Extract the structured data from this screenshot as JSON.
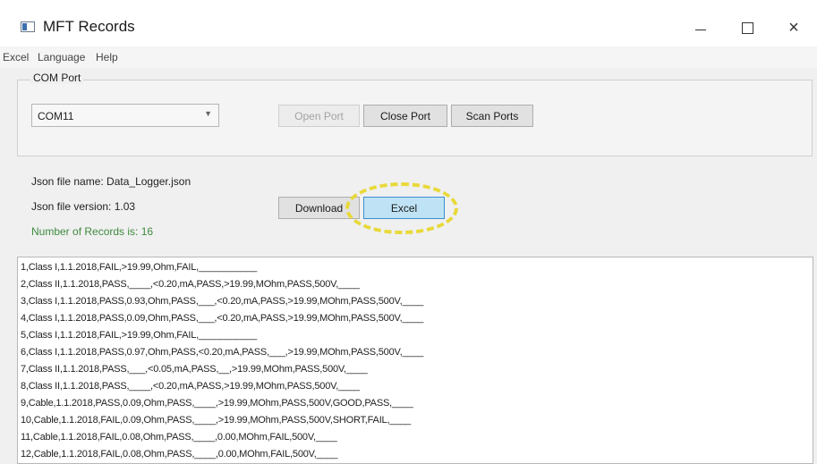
{
  "window": {
    "title": "MFT Records",
    "controls": {
      "minimize": "—",
      "maximize": "",
      "close": "×"
    }
  },
  "menu": {
    "items": [
      "Excel",
      "Language",
      "Help"
    ]
  },
  "com_port": {
    "group_label": "COM Port",
    "selected_port": "COM11",
    "open_port_label": "Open Port",
    "close_port_label": "Close Port",
    "scan_ports_label": "Scan Ports"
  },
  "info": {
    "json_file_name": "Json file name: Data_Logger.json",
    "json_file_version": "Json file version: 1.03",
    "records_count": "Number of Records is: 16",
    "download_label": "Download",
    "excel_label": "Excel"
  },
  "records": [
    "1,Class I,1.1.2018,FAIL,>19.99,Ohm,FAIL,___________",
    "2,Class II,1.1.2018,PASS,____,<0.20,mA,PASS,>19.99,MOhm,PASS,500V,____",
    "3,Class I,1.1.2018,PASS,0.93,Ohm,PASS,___,<0.20,mA,PASS,>19.99,MOhm,PASS,500V,____",
    "4,Class I,1.1.2018,PASS,0.09,Ohm,PASS,___,<0.20,mA,PASS,>19.99,MOhm,PASS,500V,____",
    "5,Class I,1.1.2018,FAIL,>19.99,Ohm,FAIL,___________",
    "6,Class I,1.1.2018,PASS,0.97,Ohm,PASS,<0.20,mA,PASS,___,>19.99,MOhm,PASS,500V,____",
    "7,Class II,1.1.2018,PASS,___,<0.05,mA,PASS,__,>19.99,MOhm,PASS,500V,____",
    "8,Class II,1.1.2018,PASS,____,<0.20,mA,PASS,>19.99,MOhm,PASS,500V,____",
    "9,Cable,1.1.2018,PASS,0.09,Ohm,PASS,____,>19.99,MOhm,PASS,500V,GOOD,PASS,____",
    "10,Cable,1.1.2018,FAIL,0.09,Ohm,PASS,____,>19.99,MOhm,PASS,500V,SHORT,FAIL,____",
    "11,Cable,1.1.2018,FAIL,0.08,Ohm,PASS,____,0.00,MOhm,FAIL,500V,____",
    "12,Cable,1.1.2018,FAIL,0.08,Ohm,PASS,____,0.00,MOhm,FAIL,500V,____"
  ]
}
